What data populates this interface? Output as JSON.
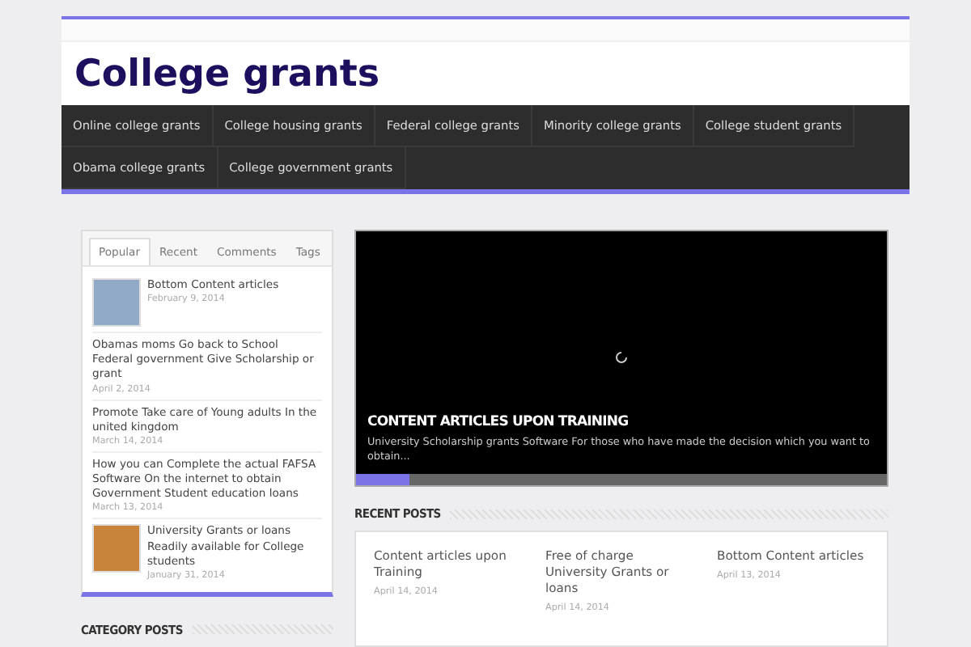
{
  "site": {
    "title": "College grants"
  },
  "nav": {
    "items": [
      "Online college grants",
      "College housing grants",
      "Federal college grants",
      "Minority college grants",
      "College student grants",
      "Obama college grants",
      "College government grants"
    ]
  },
  "sidebar": {
    "tabs": [
      {
        "label": "Popular",
        "selected": true
      },
      {
        "label": "Recent",
        "selected": false
      },
      {
        "label": "Comments",
        "selected": false
      },
      {
        "label": "Tags",
        "selected": false
      }
    ],
    "posts": [
      {
        "kind": "thumb",
        "title": "Bottom Content articles",
        "date": "February 9, 2014"
      },
      {
        "kind": "text",
        "title": "Obamas moms Go back to School Federal government Give Scholarship or grant",
        "date": "April 2, 2014"
      },
      {
        "kind": "text",
        "title": "Promote Take care of Young adults In the united kingdom",
        "date": "March 14, 2014"
      },
      {
        "kind": "text",
        "title": "How you can Complete the actual FAFSA Software On the internet to obtain Government Student education loans",
        "date": "March 13, 2014"
      },
      {
        "kind": "thumb",
        "title": "University Grants or loans Readily available for College students",
        "date": "January 31, 2014"
      }
    ],
    "section_title": "CATEGORY POSTS"
  },
  "slider": {
    "title": "CONTENT ARTICLES UPON TRAINING",
    "excerpt": "University Scholarship grants Software For those who have made the decision which you want to obtain...",
    "level": 0.1
  },
  "recent": {
    "title": "RECENT POSTS",
    "posts": [
      {
        "title": "Content articles upon Training",
        "date": "April 14, 2014"
      },
      {
        "title": "Free of charge University Grants or loans",
        "date": "April 14, 2014"
      },
      {
        "title": "Bottom Content articles",
        "date": "April 13, 2014"
      }
    ]
  }
}
